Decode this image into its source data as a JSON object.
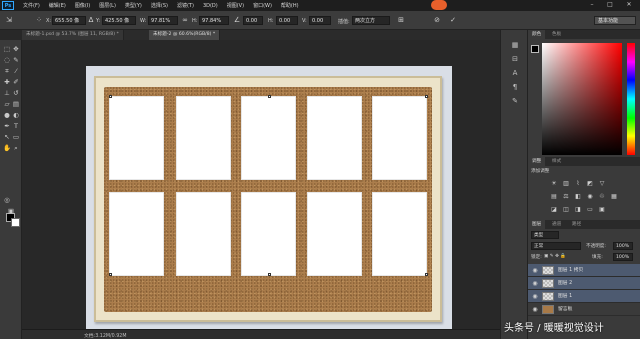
{
  "app": {
    "logo": "Ps",
    "menu": [
      "文件(F)",
      "编辑(E)",
      "图像(I)",
      "图层(L)",
      "类型(Y)",
      "选择(S)",
      "滤镜(T)",
      "3D(D)",
      "视图(V)",
      "窗口(W)",
      "帮助(H)"
    ]
  },
  "options_bar": {
    "x_label": "X:",
    "x_value": "655.50 像",
    "y_label": "Y:",
    "y_value": "425.50 像",
    "w_label": "W:",
    "w_value": "97.81%",
    "h_label": "H:",
    "h_value": "97.84%",
    "angle_value": "0.00",
    "hskew_label": "H:",
    "hskew_value": "0.00",
    "vskew_label": "V:",
    "vskew_value": "0.00",
    "interp_label": "插值:",
    "interp_value": "两次立方",
    "workspace": "基本功能"
  },
  "tabs": [
    {
      "label": "未标题-1.psd @ 53.7% (图层 11, RGB/8) *",
      "active": false
    },
    {
      "label": "未标题-2 @ 60.6%(RGB/8) *",
      "active": true
    }
  ],
  "right_panels": {
    "color_tabs": [
      "颜色",
      "色板"
    ],
    "adjust_tabs": [
      "调整",
      "样式"
    ],
    "adjust_heading": "添加调整",
    "layers_tabs": [
      "图层",
      "通道",
      "路径"
    ],
    "kind_label": "类型",
    "blend_mode": "正常",
    "opacity_label": "不透明度:",
    "opacity_value": "100%",
    "lock_label": "锁定:",
    "fill_label": "填充:",
    "fill_value": "100%"
  },
  "layers": [
    {
      "name": "图层 1 拷贝",
      "selected": true,
      "thumb": "transparent"
    },
    {
      "name": "图层 2",
      "selected": true,
      "thumb": "transparent"
    },
    {
      "name": "图层 1",
      "selected": true,
      "thumb": "transparent"
    },
    {
      "name": "留言板",
      "selected": false,
      "thumb": "photo"
    }
  ],
  "status": {
    "doc_size": "文档:3.12M/0.92M"
  },
  "watermark": "头条号 / 暖暖视觉设计",
  "colors": {
    "foreground": "#000000",
    "background": "#ffffff",
    "accent": "#e8602b"
  }
}
